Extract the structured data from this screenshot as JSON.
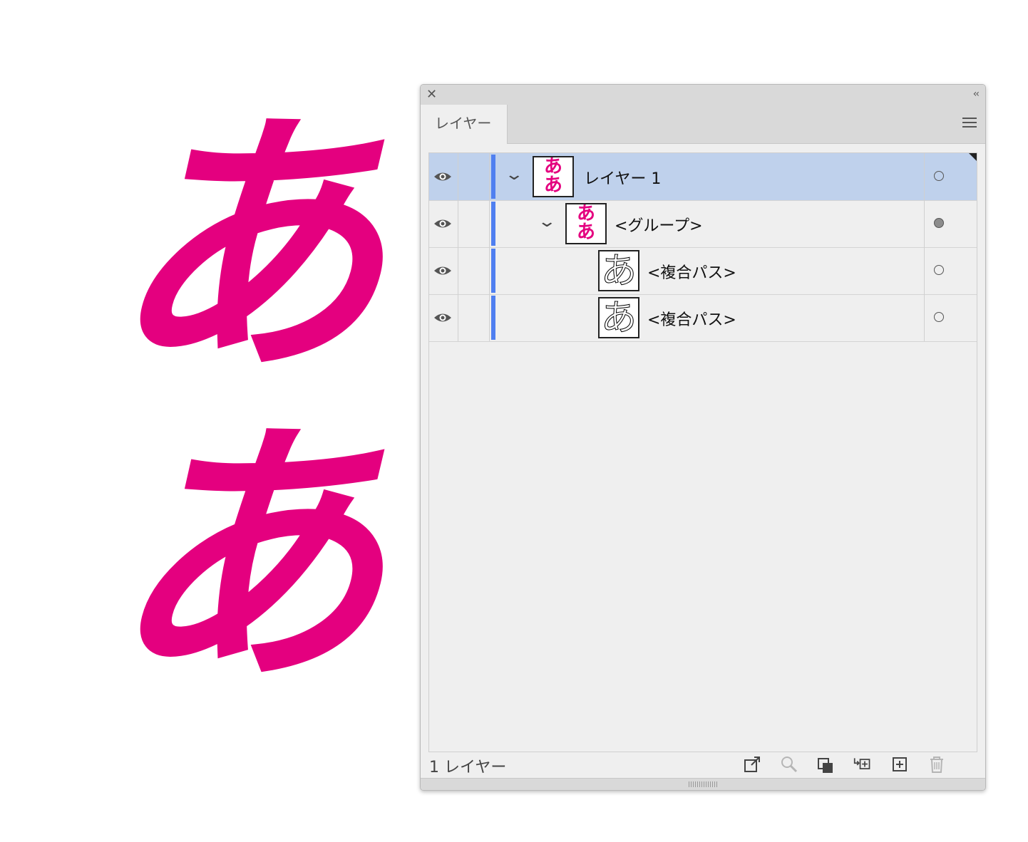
{
  "colors": {
    "accent": "#e4007f",
    "selected_row": "#bfd1ec",
    "layer_color": "#4f7ff0"
  },
  "artwork": {
    "glyph_top": "あ",
    "glyph_bottom": "あ"
  },
  "panel": {
    "tab_label": "レイヤー",
    "collapse_label": "‹‹",
    "close_label": "✕",
    "rows": [
      {
        "name": "レイヤー 1",
        "thumb": [
          "あ",
          "あ"
        ],
        "expanded": true,
        "selected": true,
        "target_filled": false
      },
      {
        "name": "<グループ>",
        "thumb": [
          "あ",
          "あ"
        ],
        "expanded": true,
        "selected": false,
        "target_filled": true
      },
      {
        "name": "<複合パス>",
        "thumb": [
          "あ"
        ],
        "selected": false,
        "target_filled": false
      },
      {
        "name": "<複合パス>",
        "thumb": [
          "あ"
        ],
        "selected": false,
        "target_filled": false
      }
    ],
    "footer": {
      "layer_count": "1 レイヤー",
      "buttons": [
        "export-icon",
        "search-icon",
        "clipping-mask-icon",
        "sublayer-icon",
        "new-layer-icon",
        "trash-icon"
      ]
    }
  }
}
